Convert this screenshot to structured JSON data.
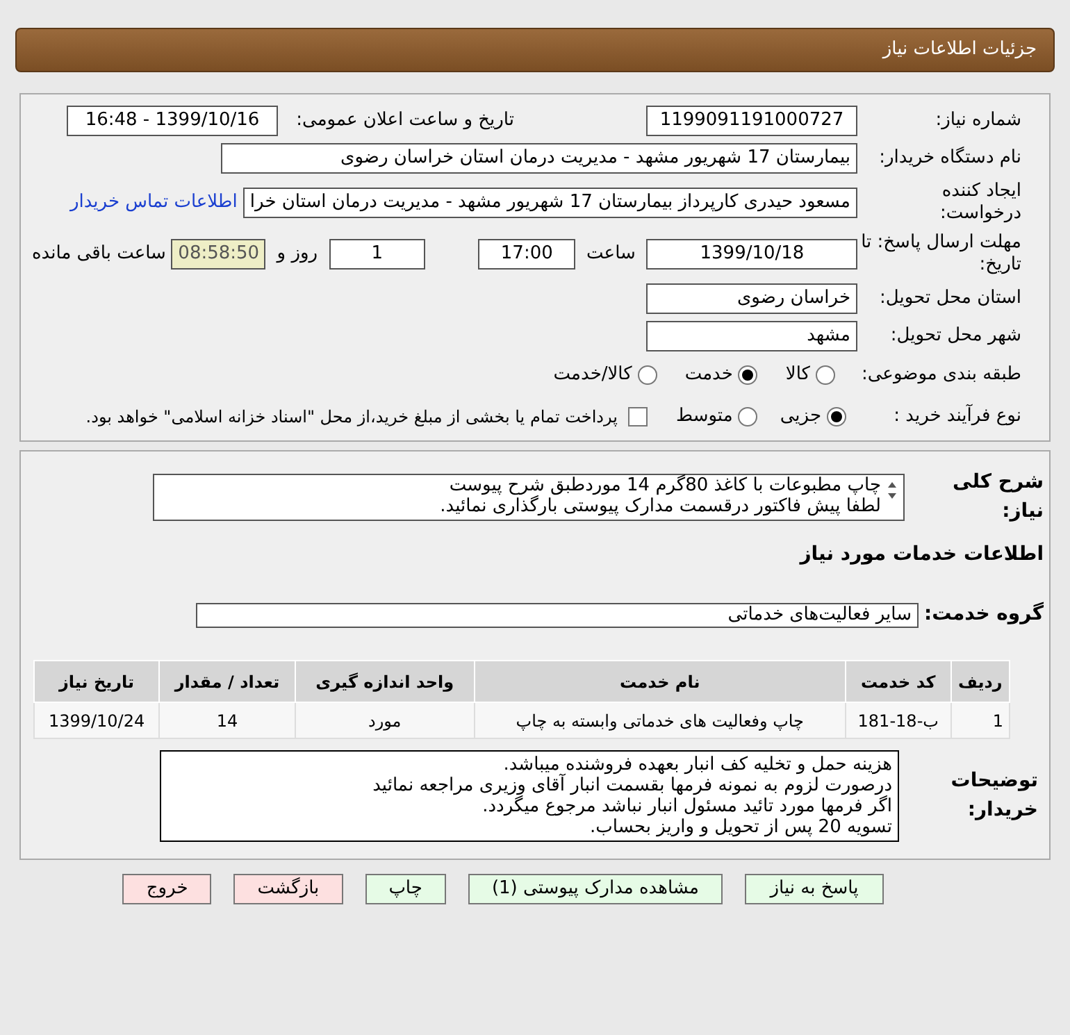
{
  "header": {
    "title": "جزئیات اطلاعات نیاز"
  },
  "need_number": {
    "label": "شماره نیاز:",
    "value": "1199091191000727"
  },
  "announce": {
    "label": "تاریخ و ساعت اعلان عمومی:",
    "value": "1399/10/16 - 16:48"
  },
  "buyer": {
    "label": "نام دستگاه خریدار:",
    "value": "بیمارستان 17 شهریور مشهد - مدیریت درمان استان خراسان رضوی"
  },
  "creator": {
    "label": "ایجاد کننده درخواست:",
    "value": "مسعود حیدری کارپرداز بیمارستان 17 شهریور مشهد - مدیریت درمان استان خرا",
    "link": "اطلاعات تماس خریدار"
  },
  "deadline": {
    "label": "مهلت ارسال پاسخ: تا تاریخ:",
    "date": "1399/10/18",
    "time_label": "ساعت",
    "time": "17:00",
    "days": "1",
    "days_label": "روز و",
    "remaining": "08:58:50",
    "remaining_label": "ساعت باقی مانده"
  },
  "province": {
    "label": "استان محل تحویل:",
    "value": "خراسان رضوی"
  },
  "city": {
    "label": "شهر محل تحویل:",
    "value": "مشهد"
  },
  "category": {
    "label": "طبقه بندی موضوعی:",
    "options": [
      {
        "label": "کالا",
        "selected": false
      },
      {
        "label": "خدمت",
        "selected": true
      },
      {
        "label": "کالا/خدمت",
        "selected": false
      }
    ]
  },
  "purchase_type": {
    "label": "نوع فرآیند خرید :",
    "options": [
      {
        "label": "جزیی",
        "selected": true
      },
      {
        "label": "متوسط",
        "selected": false
      }
    ],
    "payment": {
      "label": "پرداخت تمام یا بخشی از مبلغ خرید،از محل \"اسناد خزانه اسلامی\" خواهد بود.",
      "checked": false
    }
  },
  "summary": {
    "label": "شرح کلی نیاز:",
    "lines": [
      "چاپ مطبوعات با کاغذ 80گرم 14 موردطبق شرح پیوست",
      "لطفا پیش فاکتور درقسمت مدارک پیوستی بارگذاری نمائید."
    ]
  },
  "services_title": "اطلاعات خدمات مورد نیاز",
  "service_group": {
    "label": "گروه خدمت:",
    "value": "سایر فعالیت‌های خدماتی"
  },
  "table": {
    "columns": [
      "ردیف",
      "کد خدمت",
      "نام خدمت",
      "واحد اندازه گیری",
      "تعداد / مقدار",
      "تاریخ نیاز"
    ],
    "rows": [
      [
        "1",
        "ب-18-181",
        "چاپ وفعالیت های خدماتی وابسته به چاپ",
        "مورد",
        "14",
        "1399/10/24"
      ]
    ]
  },
  "buyer_notes": {
    "label": "توضیحات خریدار:",
    "lines": [
      "هزینه حمل و تخلیه کف انبار بعهده فروشنده میباشد.",
      "درصورت لزوم به نمونه فرمها  بقسمت انبار آقای وزیری مراجعه نمائید",
      "اگر فرمها مورد تائید مسئول انبار نباشد مرجوع میگردد.",
      "تسویه 20 پس از تحویل و واریز بحساب."
    ]
  },
  "buttons": [
    {
      "label": "پاسخ به نیاز",
      "kind": "normal"
    },
    {
      "label": "مشاهده مدارک پیوستی (1)",
      "kind": "normal"
    },
    {
      "label": "چاپ",
      "kind": "normal"
    },
    {
      "label": "بازگشت",
      "kind": "danger"
    },
    {
      "label": "خروج",
      "kind": "danger"
    }
  ]
}
